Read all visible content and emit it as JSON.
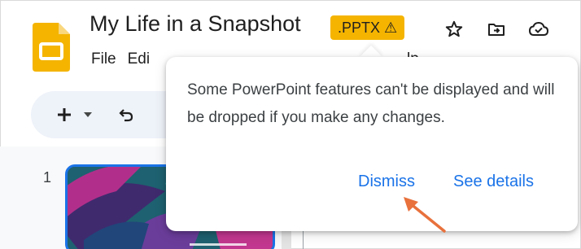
{
  "document": {
    "title": "My Life in a Snapshot",
    "badge": ".PPTX ⚠"
  },
  "icons": {
    "app": "google-slides-icon",
    "star": "star-icon",
    "move": "move-to-folder-icon",
    "cloud": "cloud-status-icon",
    "add": "add-icon",
    "add_dropdown": "chevron-down-icon",
    "undo": "undo-icon"
  },
  "menubar": {
    "items": [
      "File",
      "Edi"
    ],
    "tail": "lp"
  },
  "slides": {
    "current_number": "1"
  },
  "popup": {
    "message": "Some PowerPoint features can't be displayed and will be dropped if you make any changes.",
    "dismiss_label": "Dismiss",
    "details_label": "See details"
  },
  "colors": {
    "badge": "#f5b400",
    "accent": "#1a73e8",
    "annotation_arrow": "#e8713c",
    "slides_brand": "#f4b400"
  }
}
